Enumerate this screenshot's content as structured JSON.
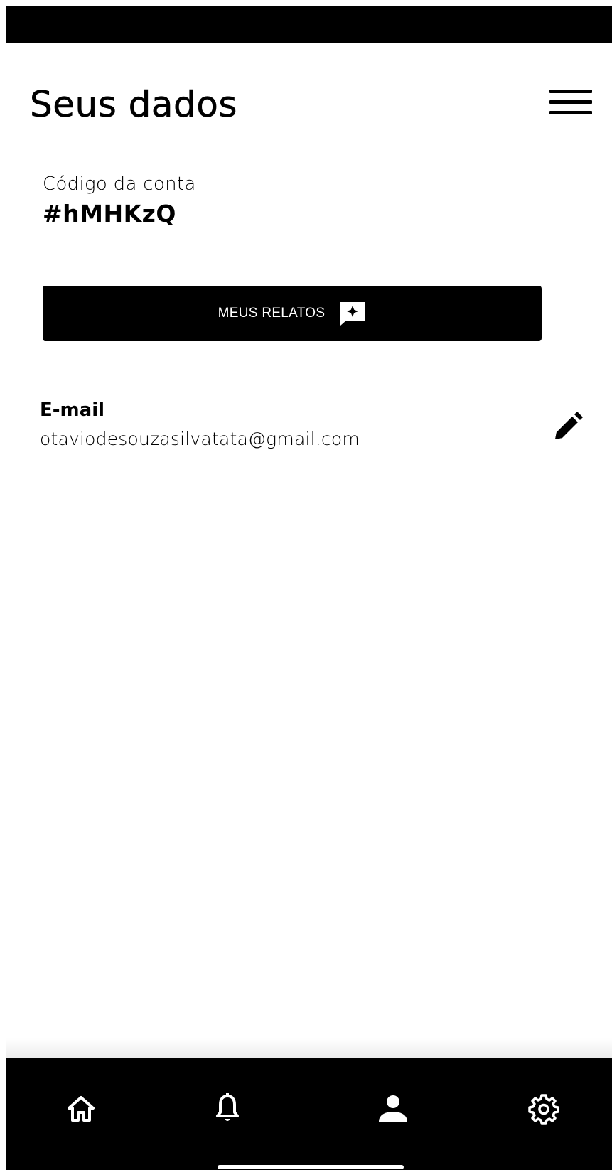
{
  "header": {
    "title": "Seus dados",
    "menu_icon": "hamburger-menu-icon"
  },
  "account": {
    "label": "Código da conta",
    "code": "#hMHKzQ"
  },
  "reports_button": {
    "label": "MEUS RELATOS",
    "icon": "feedback-sparkle-icon"
  },
  "email": {
    "label": "E-mail",
    "value": "otaviodesouzasilvatata@gmail.com",
    "edit_icon": "pencil-icon"
  },
  "bottom_nav": {
    "items": [
      {
        "icon": "home-icon"
      },
      {
        "icon": "bell-icon"
      },
      {
        "icon": "person-icon"
      },
      {
        "icon": "gear-icon"
      }
    ]
  },
  "colors": {
    "background": "#ffffff",
    "primary": "#000000",
    "on_primary": "#ffffff"
  }
}
